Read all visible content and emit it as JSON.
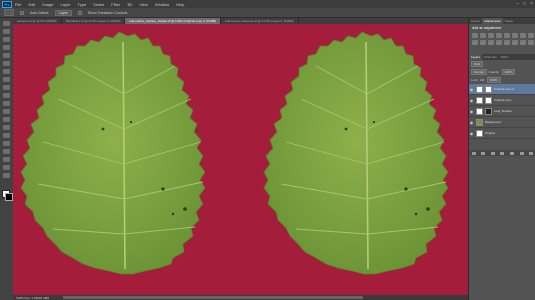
{
  "menubar": {
    "logo": "Ps",
    "items": [
      "File",
      "Edit",
      "Image",
      "Layer",
      "Type",
      "Select",
      "Filter",
      "3D",
      "View",
      "Window",
      "Help"
    ]
  },
  "optionsbar": {
    "auto_select_label": "Auto-Select:",
    "auto_select_value": "Layer",
    "transform_label": "Show Transform Controls"
  },
  "tabs": [
    {
      "label": "sample1.tif @ 12.5% (RGB/8)",
      "active": false
    },
    {
      "label": "TENSILE 1.tif @ 12.5% (Layer 0, RGB/8)",
      "active": false
    },
    {
      "label": "leaf-outline_Surface_Scatter.tif @ 100% (Original copy 2, RGB/8)",
      "active": true
    },
    {
      "label": "leaf-texture-reference.tif @ 12.5% (Layer 0, RGB/8)",
      "active": false
    }
  ],
  "status": {
    "zoom_doc": "100%  Doc: 1.09M/4.38M"
  },
  "panels": {
    "top_tabs": [
      "Library",
      "Adjustments",
      "Styles"
    ],
    "adjust_title": "Add an adjustment",
    "layer_tabs": [
      "Layers",
      "Channels",
      "Paths"
    ],
    "kind_label": "Kind",
    "blend_mode": "Normal",
    "opacity_label": "Opacity:",
    "opacity_value": "100%",
    "lock_label": "Lock:",
    "fill_label": "Fill:",
    "fill_value": "100%",
    "layers": [
      {
        "name": "Original copy 2",
        "selected": true,
        "thumb": "white",
        "mask": "white"
      },
      {
        "name": "Original copy",
        "selected": false,
        "thumb": "white",
        "mask": "white"
      },
      {
        "name": "Leaf_Surface",
        "selected": false,
        "thumb": "white",
        "mask": "dark"
      },
      {
        "name": "Background",
        "selected": false,
        "thumb": "leaf",
        "mask": "none"
      },
      {
        "name": "Original",
        "selected": false,
        "thumb": "white",
        "mask": "none"
      }
    ]
  },
  "colors": {
    "canvas_bg": "#a41e3c",
    "leaf": "#7ca43f",
    "panel_bg": "#535353",
    "selection": "#5d7a9c"
  }
}
